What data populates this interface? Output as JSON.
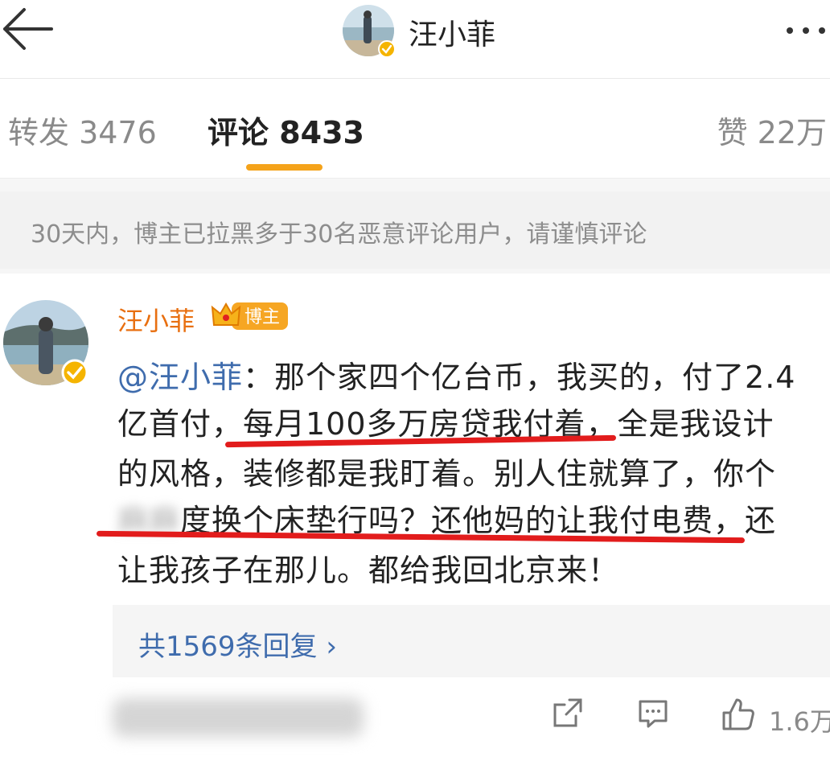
{
  "header": {
    "title": "汪小菲"
  },
  "tabs": [
    {
      "label": "转发 3476"
    },
    {
      "label": "评论 8433"
    },
    {
      "label": "赞 22万"
    }
  ],
  "notice": "30天内，博主已拉黑多于30名恶意评论用户，请谨慎评论",
  "comment": {
    "author": "汪小菲",
    "badge": "博主",
    "mention": "@汪小菲",
    "lines": [
      "：那个家四个亿台币，我买的，付了2.4",
      "亿首付，每月100多万房贷我付着，全是我设计",
      "的风格，装修都是我盯着。别人住就算了，你个",
      "度换个床垫行吗？还他妈的让我付电费，还",
      "让我孩子在那儿。都给我回北京来！"
    ],
    "blurred_text": "麻麻",
    "replies_link": "共1569条回复 ›",
    "like_count": "1.6万"
  },
  "colors": {
    "accent_orange": "#f5a31a",
    "link_blue": "#3f6cad",
    "name_orange": "#e86f10",
    "highlight_red": "#e21c1c"
  },
  "icons": [
    "back-arrow-icon",
    "more-dots-icon",
    "verified-icon",
    "crown-icon",
    "share-icon",
    "comment-icon",
    "thumbs-up-icon"
  ]
}
